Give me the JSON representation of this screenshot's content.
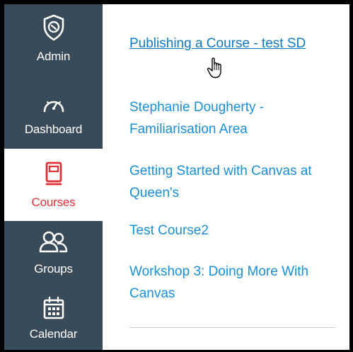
{
  "nav": {
    "admin": {
      "label": "Admin",
      "icon": "admin-shield-icon"
    },
    "dashboard": {
      "label": "Dashboard",
      "icon": "dashboard-gauge-icon"
    },
    "courses": {
      "label": "Courses",
      "icon": "courses-book-icon"
    },
    "groups": {
      "label": "Groups",
      "icon": "groups-people-icon"
    },
    "calendar": {
      "label": "Calendar",
      "icon": "calendar-icon"
    }
  },
  "courses_tray": {
    "items": [
      {
        "label": "Publishing a Course - test SD"
      },
      {
        "label": "Stephanie Dougherty - Familiarisation Area"
      },
      {
        "label": "Getting Started with Canvas at Queen's"
      },
      {
        "label": "Test Course2"
      },
      {
        "label": "Workshop 3: Doing More With Canvas"
      }
    ]
  },
  "colors": {
    "nav_background": "#394b58",
    "active_accent": "#e12f36",
    "link": "#1b8fd3"
  }
}
